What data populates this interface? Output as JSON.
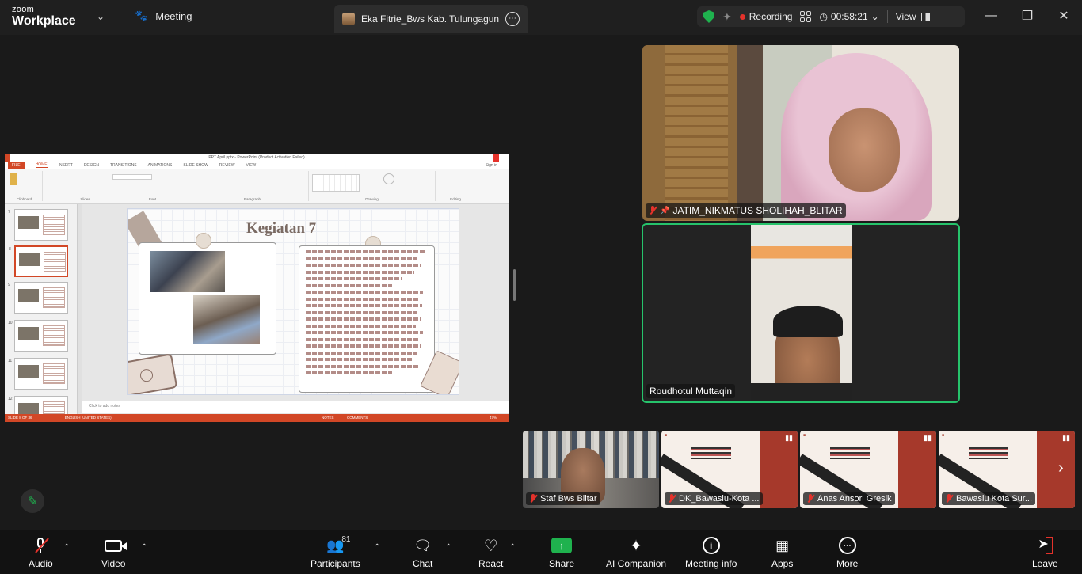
{
  "app": {
    "brand_small": "zoom",
    "brand_large": "Workplace",
    "meeting_tab": "Meeting",
    "title": "Eka Fitrie_Bws Kab. Tulungagung'"
  },
  "status_bar": {
    "recording": "Recording",
    "timer": "00:58:21",
    "view": "View"
  },
  "shared_screen": {
    "window_title": "PPT April.pptx - PowerPoint (Product Activation Failed)",
    "ribbon_tabs": [
      "FILE",
      "HOME",
      "INSERT",
      "DESIGN",
      "TRANSITIONS",
      "ANIMATIONS",
      "SLIDE SHOW",
      "REVIEW",
      "VIEW"
    ],
    "sign_in": "Sign in",
    "ribbon_groups": [
      "Clipboard",
      "Slides",
      "Font",
      "Paragraph",
      "Drawing",
      "Editing"
    ],
    "slide_title": "Kegiatan 7",
    "notes_placeholder": "Click to add notes",
    "status_left": "SLIDE 8 OF 36",
    "status_lang": "ENGLISH (UNITED STATES)",
    "status_notes": "NOTES",
    "status_comments": "COMMENTS",
    "zoom": "47%",
    "thumbnail_numbers": [
      "7",
      "8",
      "9",
      "10",
      "11",
      "12"
    ]
  },
  "participants_video": [
    {
      "name": "JATIM_NIKMATUS SHOLIHAH_BLITAR"
    },
    {
      "name": "Roudhotul Muttaqin"
    }
  ],
  "filmstrip": [
    {
      "name": "Staf Bws Blitar"
    },
    {
      "name": "DK_Bawaslu-Kota ..."
    },
    {
      "name": "Anas Ansori Gresik"
    },
    {
      "name": "Bawaslu Kota Sur..."
    }
  ],
  "toolbar": {
    "audio": "Audio",
    "video": "Video",
    "participants": "Participants",
    "participants_count": "81",
    "chat": "Chat",
    "react": "React",
    "share": "Share",
    "ai": "AI Companion",
    "info": "Meeting info",
    "apps": "Apps",
    "more": "More",
    "leave": "Leave"
  },
  "colors": {
    "active_speaker": "#26c36b",
    "share_green": "#1fb24e",
    "recording_red": "#e4322b",
    "powerpoint_accent": "#d24726"
  }
}
